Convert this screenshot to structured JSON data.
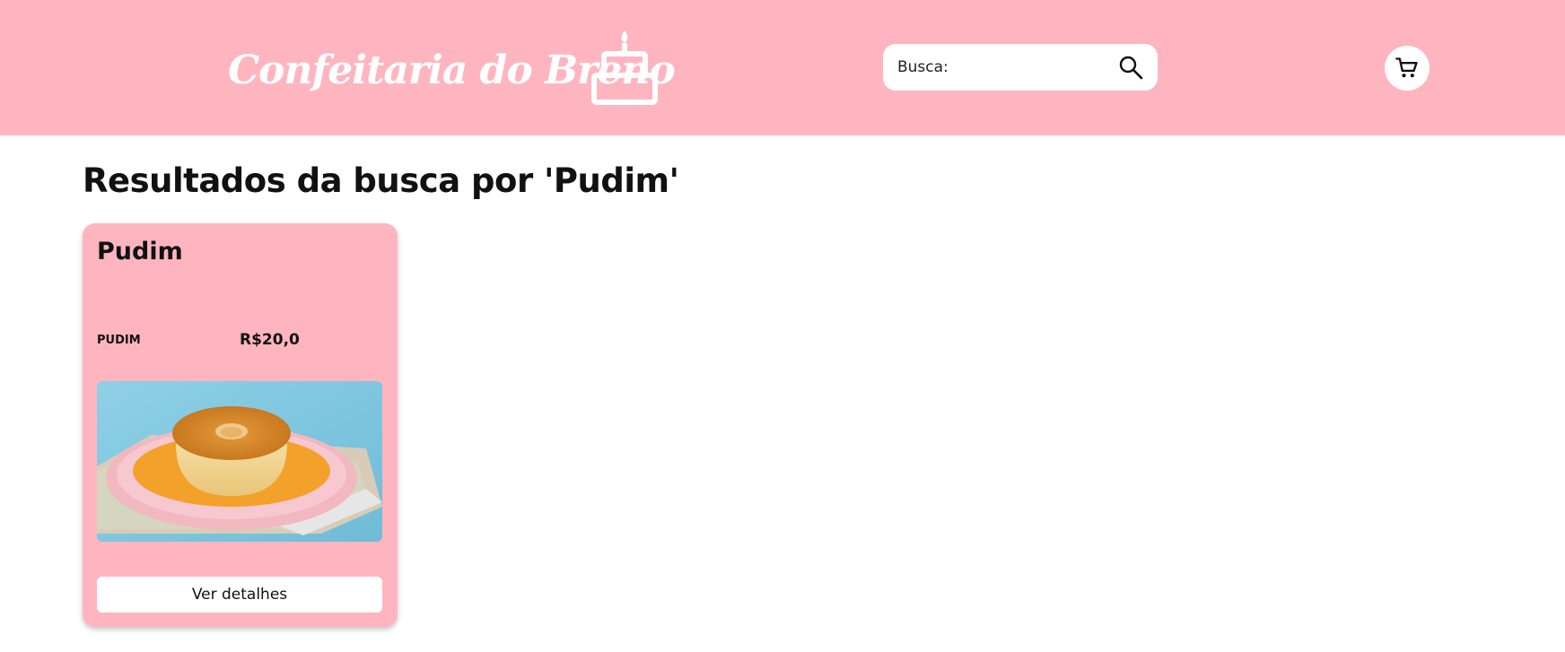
{
  "header": {
    "brand": "Confeitaria do Breno",
    "logo_icon": "cake-icon",
    "search_label": "Busca:",
    "search_value": "",
    "search_placeholder": "",
    "search_icon": "search-icon",
    "cart_icon": "cart-icon",
    "background_color": "#ffb5c0"
  },
  "main": {
    "results_title": "Resultados da busca por 'Pudim'",
    "products": [
      {
        "name": "Pudim",
        "category": "PUDIM",
        "price": "R$20,0",
        "image": "pudim-photo",
        "button_label": "Ver detalhes"
      }
    ]
  }
}
